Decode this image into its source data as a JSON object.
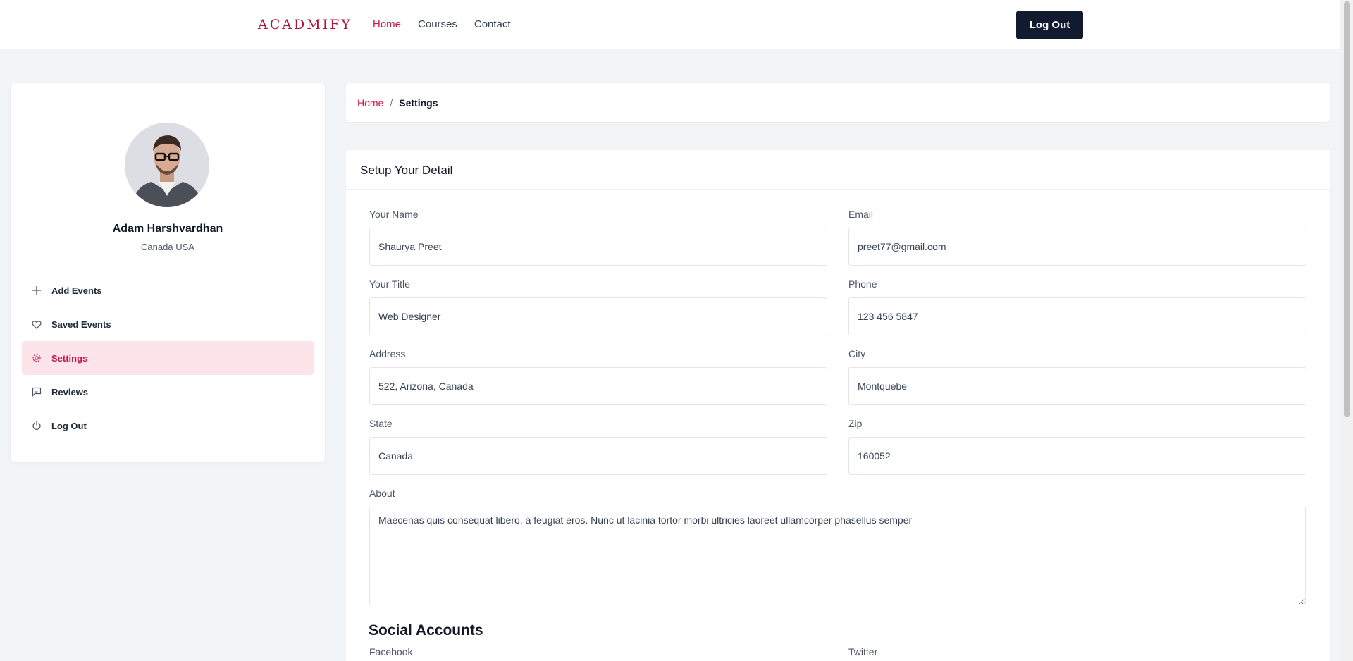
{
  "header": {
    "logo_text": "ACADMIFY",
    "nav": [
      "Home",
      "Courses",
      "Contact"
    ],
    "logout_label": "Log Out"
  },
  "profile": {
    "name": "Adam Harshvardhan",
    "location": "Canada USA",
    "avatar_icon": "user-avatar"
  },
  "sidebar": {
    "items": [
      {
        "label": "Add Events",
        "icon": "plus-icon"
      },
      {
        "label": "Saved Events",
        "icon": "heart-icon"
      },
      {
        "label": "Settings",
        "icon": "gear-icon",
        "active": true
      },
      {
        "label": "Reviews",
        "icon": "chat-icon"
      },
      {
        "label": "Log Out",
        "icon": "power-icon"
      }
    ]
  },
  "breadcrumb": {
    "home": "Home",
    "separator": "/",
    "current": "Settings"
  },
  "form": {
    "title": "Setup Your Detail",
    "your_name": {
      "label": "Your Name",
      "value": "Shaurya Preet"
    },
    "email": {
      "label": "Email",
      "value": "preet77@gmail.com"
    },
    "your_title": {
      "label": "Your Title",
      "value": "Web Designer"
    },
    "phone": {
      "label": "Phone",
      "value": "123 456 5847"
    },
    "address": {
      "label": "Address",
      "value": "522, Arizona, Canada"
    },
    "city": {
      "label": "City",
      "value": "Montquebe"
    },
    "state": {
      "label": "State",
      "value": "Canada"
    },
    "zip": {
      "label": "Zip",
      "value": "160052"
    },
    "about": {
      "label": "About",
      "value": "Maecenas quis consequat libero, a feugiat eros. Nunc ut lacinia tortor morbi ultricies laoreet ullamcorper phasellus semper"
    },
    "social_heading": "Social Accounts",
    "facebook_label": "Facebook",
    "twitter_label": "Twitter"
  },
  "colors": {
    "accent": "#d0134a",
    "dark": "#111a2e",
    "active_bg": "#fde4ea"
  }
}
